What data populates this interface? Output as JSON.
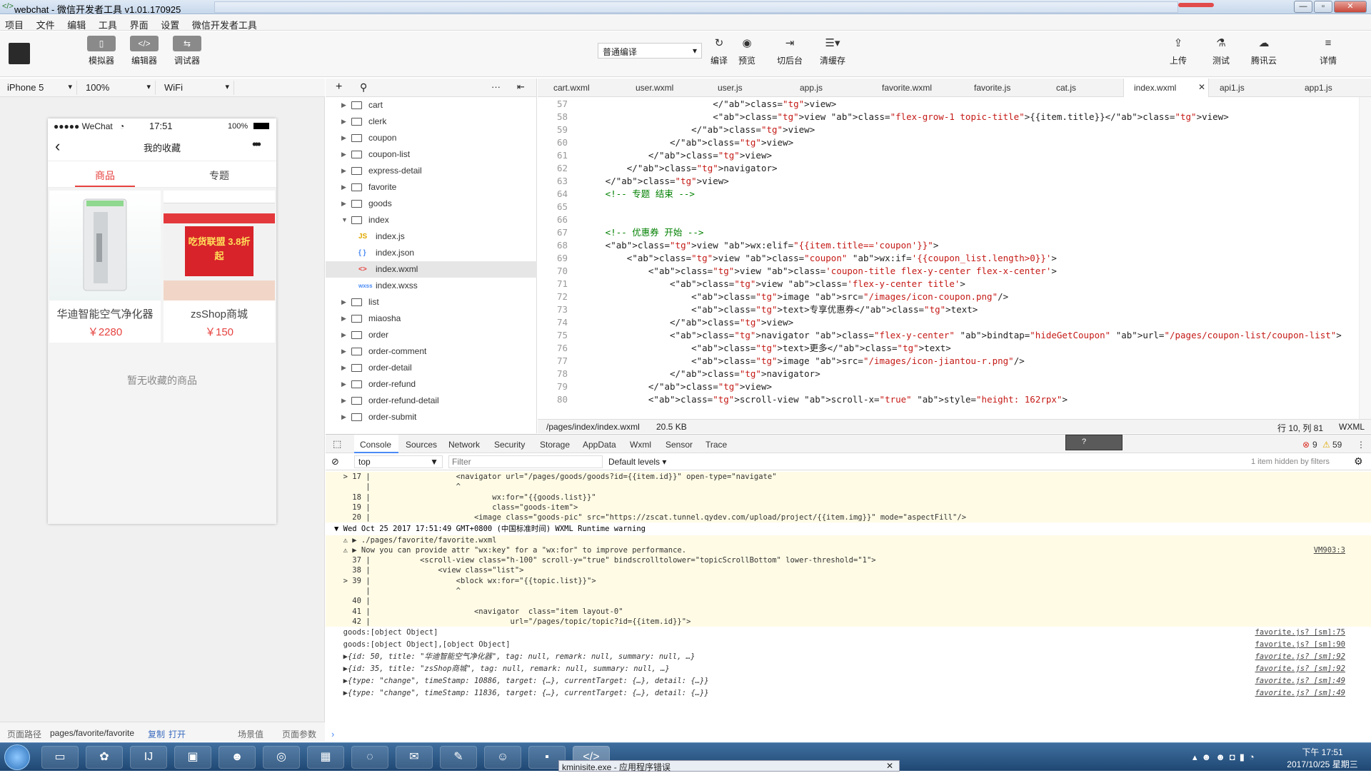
{
  "window": {
    "title": "webchat - 微信开发者工具 v1.01.170925"
  },
  "menu": [
    "项目",
    "文件",
    "编辑",
    "工具",
    "界面",
    "设置",
    "微信开发者工具"
  ],
  "toolbar": {
    "left": [
      {
        "label": "模拟器",
        "icon": "phone-icon"
      },
      {
        "label": "编辑器",
        "icon": "code-icon"
      },
      {
        "label": "调试器",
        "icon": "debug-icon"
      }
    ],
    "compile_select": "普通编译",
    "center": [
      {
        "label": "编译",
        "icon": "refresh-icon"
      },
      {
        "label": "预览",
        "icon": "eye-icon"
      },
      {
        "label": "切后台",
        "icon": "switch-icon"
      },
      {
        "label": "清缓存",
        "icon": "layers-icon"
      }
    ],
    "right": [
      {
        "label": "上传",
        "icon": "upload-icon"
      },
      {
        "label": "测试",
        "icon": "flask-icon"
      },
      {
        "label": "腾讯云",
        "icon": "cloud-icon"
      },
      {
        "label": "详情",
        "icon": "menu-icon"
      }
    ]
  },
  "devbar": {
    "device": "iPhone 5",
    "zoom": "100%",
    "network": "WiFi"
  },
  "phone": {
    "carrier": "●●●●● WeChat",
    "time": "17:51",
    "battery": "100%",
    "nav_title": "我的收藏",
    "tabs": [
      "商品",
      "专题"
    ],
    "goods": [
      {
        "name": "华迪智能空气净化器",
        "price": "￥2280"
      },
      {
        "name": "zsShop商城",
        "price": "￥150"
      }
    ],
    "empty_text": "暂无收藏的商品",
    "promo_text": "吃货联盟 3.8折起"
  },
  "simfoot": {
    "path_label": "页面路径",
    "path": "pages/favorite/favorite",
    "copy": "复制",
    "open": "打开",
    "scene": "场景值",
    "params": "页面参数"
  },
  "files": [
    {
      "name": "cart",
      "type": "folder"
    },
    {
      "name": "clerk",
      "type": "folder"
    },
    {
      "name": "coupon",
      "type": "folder"
    },
    {
      "name": "coupon-list",
      "type": "folder"
    },
    {
      "name": "express-detail",
      "type": "folder"
    },
    {
      "name": "favorite",
      "type": "folder"
    },
    {
      "name": "goods",
      "type": "folder"
    },
    {
      "name": "index",
      "type": "folder-open"
    },
    {
      "name": "index.js",
      "type": "js"
    },
    {
      "name": "index.json",
      "type": "json"
    },
    {
      "name": "index.wxml",
      "type": "wxml",
      "selected": true
    },
    {
      "name": "index.wxss",
      "type": "wxss"
    },
    {
      "name": "list",
      "type": "folder"
    },
    {
      "name": "miaosha",
      "type": "folder"
    },
    {
      "name": "order",
      "type": "folder"
    },
    {
      "name": "order-comment",
      "type": "folder"
    },
    {
      "name": "order-detail",
      "type": "folder"
    },
    {
      "name": "order-refund",
      "type": "folder"
    },
    {
      "name": "order-refund-detail",
      "type": "folder"
    },
    {
      "name": "order-submit",
      "type": "folder"
    }
  ],
  "editor_tabs": [
    "cart.wxml",
    "user.wxml",
    "user.js",
    "app.js",
    "favorite.wxml",
    "favorite.js",
    "cat.js",
    "index.wxml",
    "api1.js",
    "app1.js"
  ],
  "code": [
    {
      "n": "57",
      "t": "                        </view>"
    },
    {
      "n": "58",
      "t": "                        <view class=\"flex-grow-1 topic-title\">{{item.title}}</view>"
    },
    {
      "n": "59",
      "t": "                    </view>"
    },
    {
      "n": "60",
      "t": "                </view>"
    },
    {
      "n": "61",
      "t": "            </view>"
    },
    {
      "n": "62",
      "t": "        </navigator>"
    },
    {
      "n": "63",
      "t": "    </view>"
    },
    {
      "n": "64",
      "t": "    <!-- 专题 结束 -->"
    },
    {
      "n": "65",
      "t": ""
    },
    {
      "n": "66",
      "t": ""
    },
    {
      "n": "67",
      "t": "    <!-- 优惠券 开始 -->"
    },
    {
      "n": "68",
      "t": "    <view wx:elif=\"{{item.title=='coupon'}}\">"
    },
    {
      "n": "69",
      "t": "        <view class=\"coupon\" wx:if='{{coupon_list.length>0}}'>"
    },
    {
      "n": "70",
      "t": "            <view class='coupon-title flex-y-center flex-x-center'>"
    },
    {
      "n": "71",
      "t": "                <view class='flex-y-center title'>"
    },
    {
      "n": "72",
      "t": "                    <image src=\"/images/icon-coupon.png\"/>"
    },
    {
      "n": "73",
      "t": "                    <text>专享优惠券</text>"
    },
    {
      "n": "74",
      "t": "                </view>"
    },
    {
      "n": "75",
      "t": "                <navigator class=\"flex-y-center\" bindtap=\"hideGetCoupon\" url=\"/pages/coupon-list/coupon-list\">"
    },
    {
      "n": "76",
      "t": "                    <text>更多</text>"
    },
    {
      "n": "77",
      "t": "                    <image src=\"/images/icon-jiantou-r.png\"/>"
    },
    {
      "n": "78",
      "t": "                </navigator>"
    },
    {
      "n": "79",
      "t": "            </view>"
    },
    {
      "n": "80",
      "t": "            <scroll-view scroll-x=\"true\" style=\"height: 162rpx\">"
    }
  ],
  "editor_status": {
    "path": "/pages/index/index.wxml",
    "size": "20.5 KB",
    "pos": "行 10, 列 81",
    "lang": "WXML"
  },
  "console_tabs": [
    "Console",
    "Sources",
    "Network",
    "Security",
    "Storage",
    "AppData",
    "Wxml",
    "Sensor",
    "Trace"
  ],
  "console_counts": {
    "errors": "9",
    "warnings": "59"
  },
  "console_filter": {
    "context": "top",
    "placeholder": "Filter",
    "levels": "Default levels",
    "hidden": "1 item hidden by filters"
  },
  "console_lines": [
    {
      "t": "  > 17 |                   <navigator url=\"/pages/goods/goods?id={{item.id}}\" open-type=\"navigate\"",
      "w": true
    },
    {
      "t": "       |                   ^",
      "w": true
    },
    {
      "t": "    18 |                           wx:for=\"{{goods.list}}\"",
      "w": true
    },
    {
      "t": "    19 |                           class=\"goods-item\">",
      "w": true
    },
    {
      "t": "    20 |                       <image class=\"goods-pic\" src=\"https://zscat.tunnel.qydev.com/upload/project/{{item.img}}\" mode=\"aspectFill\"/>",
      "w": true
    },
    {
      "t": "▼ Wed Oct 25 2017 17:51:49 GMT+0800 (中国标准时间) WXML Runtime warning",
      "w": false
    },
    {
      "t": "  ⚠ ▶ ./pages/favorite/favorite.wxml",
      "w": true
    },
    {
      "t": "  ⚠ ▶ Now you can provide attr \"wx:key\" for a \"wx:for\" to improve performance.",
      "w": true,
      "src": "VM903:3"
    },
    {
      "t": "    37 |           <scroll-view class=\"h-100\" scroll-y=\"true\" bindscrolltolower=\"topicScrollBottom\" lower-threshold=\"1\">",
      "w": true
    },
    {
      "t": "    38 |               <view class=\"list\">",
      "w": true
    },
    {
      "t": "  > 39 |                   <block wx:for=\"{{topic.list}}\">",
      "w": true
    },
    {
      "t": "       |                   ^",
      "w": true
    },
    {
      "t": "    40 |",
      "w": true
    },
    {
      "t": "    41 |                       <navigator  class=\"item layout-0\"",
      "w": true
    },
    {
      "t": "    42 |                               url=\"/pages/topic/topic?id={{item.id}}\">",
      "w": true
    },
    {
      "t": "  goods:[object Object]",
      "w": false,
      "src": "favorite.js? [sm]:75"
    },
    {
      "t": "  goods:[object Object],[object Object]",
      "w": false,
      "src": "favorite.js? [sm]:90"
    },
    {
      "t": "  ▶{id: 50, title: \"华迪智能空气净化器\", tag: null, remark: null, summary: null, …}",
      "w": false,
      "src": "favorite.js? [sm]:92"
    },
    {
      "t": "  ▶{id: 35, title: \"zsShop商城\", tag: null, remark: null, summary: null, …}",
      "w": false,
      "src": "favorite.js? [sm]:92"
    },
    {
      "t": "  ▶{type: \"change\", timeStamp: 10886, target: {…}, currentTarget: {…}, detail: {…}}",
      "w": false,
      "src": "favorite.js? [sm]:49"
    },
    {
      "t": "  ▶{type: \"change\", timeStamp: 11836, target: {…}, currentTarget: {…}, detail: {…}}",
      "w": false,
      "src": "favorite.js? [sm]:49"
    }
  ],
  "taskbar": {
    "time": "下午 17:51",
    "date": "2017/10/25 星期三",
    "app_title": "kminisite.exe - 应用程序错误"
  },
  "colors": {
    "accent": "#e64340",
    "warning_bg": "#fffbe5",
    "taskbar": "#1f4773"
  }
}
